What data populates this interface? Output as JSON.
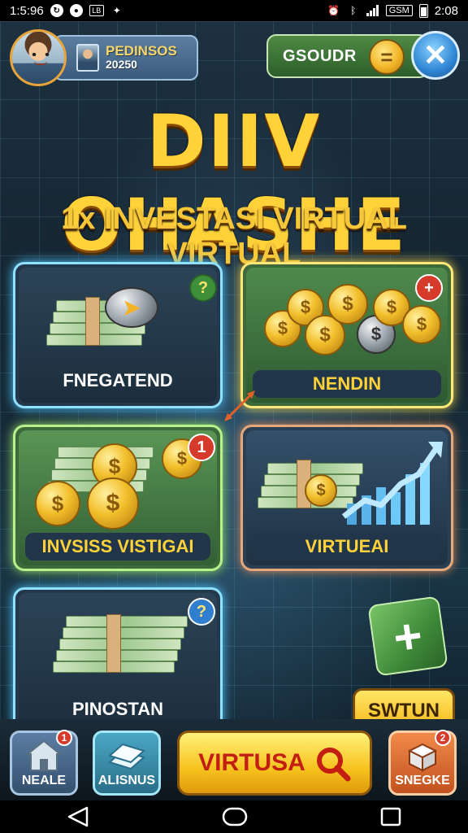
{
  "status_bar": {
    "time_left": "1:5:96",
    "time_right": "2:08",
    "icons": [
      "sync-icon",
      "circle-icon",
      "box-icon",
      "sparkle-icon",
      "alarm-icon",
      "bluetooth-icon",
      "signal-icon",
      "carrier-icon",
      "battery-icon"
    ],
    "carrier": "GSM"
  },
  "hud": {
    "player_name": "PEDINSOS",
    "player_score": "20250",
    "currency_label": "GSOUDR",
    "coin_symbol": "=",
    "close_symbol": "✕"
  },
  "title": {
    "main": "DIIV OHASHE",
    "subtitle": "1x INVESTASI VIRTUAL VIRTUAL"
  },
  "cards": [
    {
      "label": "FNEGATEND",
      "badge": "?",
      "badge_color": "#3d8f3a"
    },
    {
      "label": "NENDIN",
      "badge": "+",
      "badge_color": "#d63a2a"
    },
    {
      "label": "INVSISS VISTIGAI",
      "badge": "1",
      "badge_color": "#d63a2a"
    },
    {
      "label": "VIRTUEAI",
      "badge": "",
      "badge_color": ""
    },
    {
      "label": "PINOSTAN",
      "badge": "?",
      "badge_color": "#2f7ed0"
    }
  ],
  "side": {
    "cube_symbol": "+",
    "switch_label": "SWTUN"
  },
  "bottom_nav": {
    "home_label": "NEALE",
    "home_badge": "1",
    "assets_label": "ALISNUS",
    "main_label": "VIRTUSA",
    "shop_label": "SNEGKE",
    "shop_badge": "2"
  },
  "colors": {
    "gold": "#ffd23a",
    "accent_blue": "#8fe1ff",
    "accent_green": "#b8f08c",
    "accent_red": "#d63a2a"
  }
}
